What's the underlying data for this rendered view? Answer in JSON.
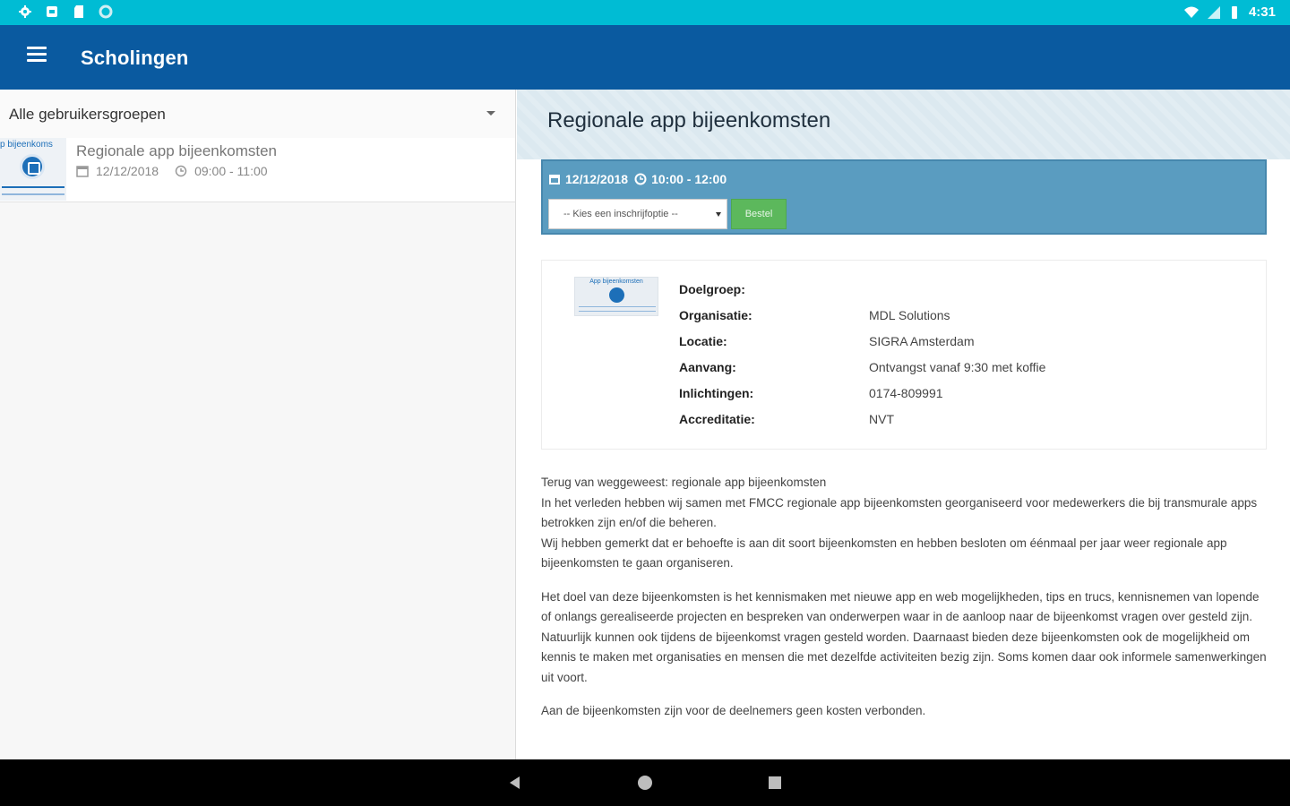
{
  "status_bar": {
    "time": "4:31",
    "left_icons": [
      "settings-icon",
      "notification-icon",
      "sd-card-icon",
      "sync-icon"
    ],
    "right_icons": [
      "wifi-icon",
      "signal-icon",
      "battery-icon"
    ]
  },
  "app_bar": {
    "title": "Scholingen",
    "menu_icon": "hamburger-menu-icon",
    "color": "#0a5aa0"
  },
  "left_pane": {
    "group_filter": {
      "selected": "Alle gebruikersgroepen"
    },
    "items": [
      {
        "thumbnail_caption": "p bijeenkoms",
        "title": "Regionale app bijeenkomsten",
        "date": "12/12/2018",
        "time": "09:00 - 11:00"
      }
    ]
  },
  "detail": {
    "title": "Regionale app bijeenkomsten",
    "datetime": {
      "date": "12/12/2018",
      "time": "10:00 - 12:00"
    },
    "registration": {
      "select_placeholder": "-- Kies een inschrijfoptie --",
      "order_button": "Bestel"
    },
    "card_image_caption": "App bijeenkomsten",
    "info": [
      {
        "label": "Doelgroep:",
        "value": ""
      },
      {
        "label": "Organisatie:",
        "value": "MDL Solutions"
      },
      {
        "label": "Locatie:",
        "value": "SIGRA Amsterdam"
      },
      {
        "label": "Aanvang:",
        "value": "Ontvangst vanaf 9:30 met koffie"
      },
      {
        "label": "Inlichtingen:",
        "value": "0174-809991"
      },
      {
        "label": "Accreditatie:",
        "value": "NVT"
      }
    ],
    "description": [
      "Terug van weggeweest: regionale app bijeenkomsten\nIn het verleden hebben wij samen met FMCC regionale app bijeenkomsten georganiseerd voor medewerkers die bij transmurale apps betrokken zijn en/of die beheren.\nWij hebben gemerkt dat er behoefte is aan dit soort bijeenkomsten en hebben besloten om éénmaal per jaar weer regionale app bijeenkomsten te gaan organiseren.",
      "Het doel van deze bijeenkomsten is het kennismaken met nieuwe app en web mogelijkheden, tips en trucs, kennisnemen van lopende of onlangs gerealiseerde projecten en bespreken van onderwerpen waar in de aanloop naar de bijeenkomst vragen over gesteld zijn.\nNatuurlijk kunnen ook tijdens de bijeenkomst vragen gesteld worden. Daarnaast bieden deze bijeenkomsten ook de mogelijkheid om kennis te maken met organisaties en mensen die met dezelfde activiteiten bezig zijn. Soms komen daar ook informele samenwerkingen uit voort.",
      "Aan de bijeenkomsten zijn voor de deelnemers geen kosten verbonden."
    ]
  },
  "colors": {
    "status_bar": "#00bcd4",
    "app_bar": "#0a5aa0",
    "order_panel": "#5a9cc0",
    "order_button": "#5cb85c"
  }
}
